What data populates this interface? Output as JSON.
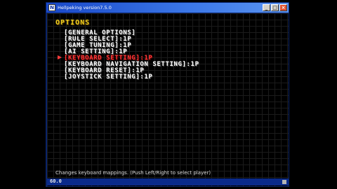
{
  "window": {
    "title": "Hellpeking version7.5.0",
    "icon": "app-icon",
    "buttons": {
      "minimize": "_",
      "maximize": "□",
      "close": "×"
    }
  },
  "screen": {
    "heading": "OPTIONS",
    "menu": [
      {
        "label": "[GENERAL OPTIONS]",
        "selected": false
      },
      {
        "label": "[RULE SELECT]:1P",
        "selected": false
      },
      {
        "label": "[GAME TUNING]:1P",
        "selected": false
      },
      {
        "label": "[AI SETTING]:1P",
        "selected": false
      },
      {
        "label": "[KEYBOARD SETTING]:1P",
        "selected": true
      },
      {
        "label": "[KEYBOARD NAVIGATION SETTING]:1P",
        "selected": false
      },
      {
        "label": "[KEYBOARD RESET]:1P",
        "selected": false
      },
      {
        "label": "[JOYSTICK SETTING]:1P",
        "selected": false
      }
    ],
    "help_text": "Changes keyboard mappings. (Push Left/Right to select player)",
    "status_left": "60.0",
    "colors": {
      "heading": "#f0d020",
      "selected": "#ff3b3b",
      "normal": "#ffffff"
    }
  }
}
